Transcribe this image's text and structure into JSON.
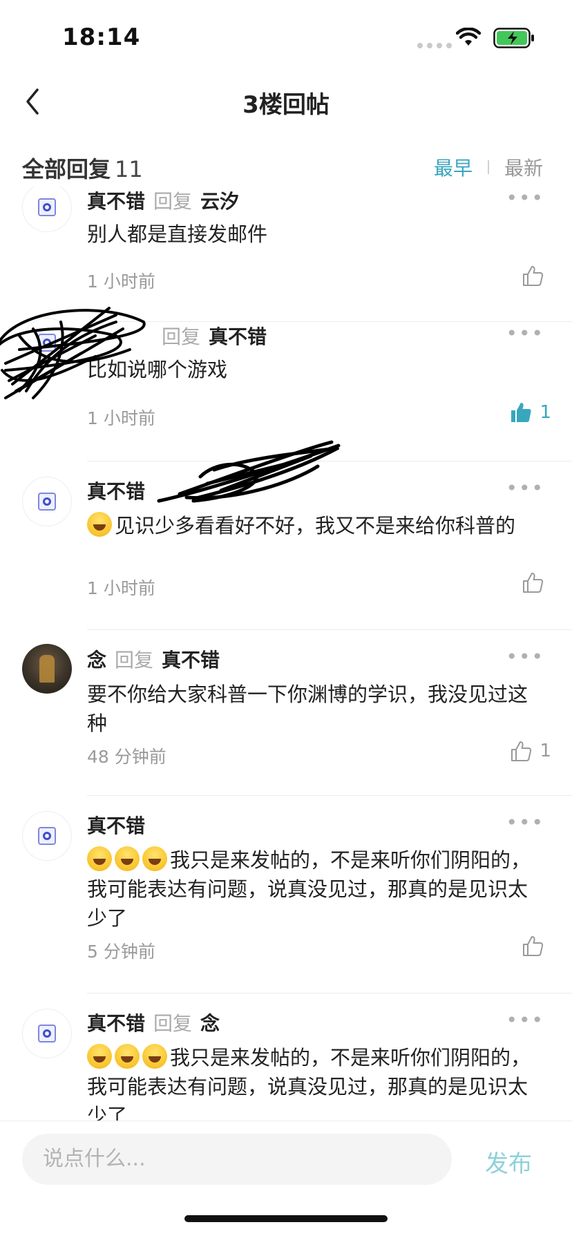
{
  "status_bar": {
    "time": "18:14"
  },
  "nav": {
    "title": "3楼回帖"
  },
  "filter": {
    "label": "全部回复",
    "count": "11",
    "sort_earliest": "最早",
    "sort_latest": "最新",
    "active_sort": "最早"
  },
  "reply_word": "回复",
  "more_glyph": "•••",
  "colors": {
    "accent": "#38a7be",
    "publish": "#8fd0dc"
  },
  "comments": [
    {
      "name": "真不错",
      "target": "云汐",
      "text": "别人都是直接发邮件",
      "time": "1 小时前",
      "likes": "",
      "liked": false
    },
    {
      "name": "",
      "target": "真不错",
      "text": "比如说哪个游戏",
      "time": "1 小时前",
      "likes": "1",
      "liked": true
    },
    {
      "name": "真不错",
      "target": "",
      "text": "见识少多看看好不好，我又不是来给你科普的",
      "time": "1 小时前",
      "likes": "",
      "liked": false
    },
    {
      "name": "念",
      "target": "真不错",
      "text": "要不你给大家科普一下你渊博的学识，我没见过这种",
      "time": "48 分钟前",
      "likes": "1",
      "liked": false
    },
    {
      "name": "真不错",
      "target": "",
      "text": "我只是来发帖的，不是来听你们阴阳的，我可能表达有问题，说真没见过，那真的是见识太少了",
      "time": "5 分钟前",
      "likes": "",
      "liked": false
    },
    {
      "name": "真不错",
      "target": "念",
      "text": "我只是来发帖的，不是来听你们阴阳的，我可能表达有问题，说真没见过，那真的是见识太少了",
      "time": "",
      "likes": "",
      "liked": false
    }
  ],
  "input": {
    "placeholder": "说点什么...",
    "publish_label": "发布"
  }
}
